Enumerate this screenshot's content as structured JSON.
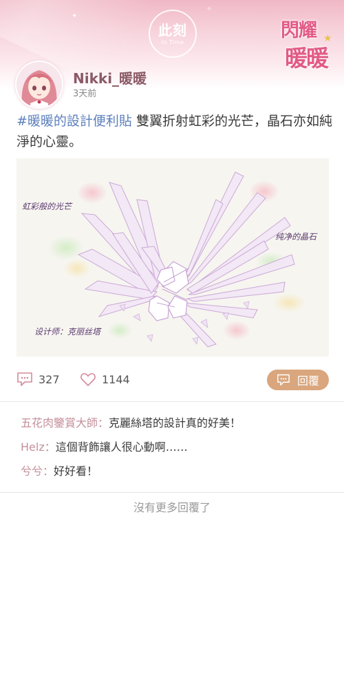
{
  "header": {
    "emblem_main": "此刻",
    "emblem_sub": "In Time",
    "logo_line1": "閃耀",
    "logo_line2": "暖暖"
  },
  "post": {
    "username": "Nikki_暖暖",
    "time": "3天前",
    "hashtag": "#暖暖的設計便利貼",
    "text": " 雙翼折射虹彩的光芒，晶石亦如純淨的心靈。",
    "image": {
      "annotation_left": "虹彩般的光芒",
      "annotation_right": "纯净的晶石",
      "annotation_designer": "设计师：克丽丝塔"
    }
  },
  "stats": {
    "comments": "327",
    "likes": "1144",
    "reply_label": "回覆"
  },
  "comments": [
    {
      "author": "五花肉鑒賞大師",
      "text": "克麗絲塔的設計真的好美！"
    },
    {
      "author": "Helz",
      "text": "這個背飾讓人很心動啊……"
    },
    {
      "author": "兮兮",
      "text": "好好看！"
    }
  ],
  "footer": {
    "no_more": "沒有更多回覆了"
  },
  "colors": {
    "header_pink": "#f0b8c6",
    "accent_tag": "#5b7fbd",
    "reply_button": "#d9a67d",
    "comment_author": "#c58f9a",
    "username": "#8b5a66"
  }
}
